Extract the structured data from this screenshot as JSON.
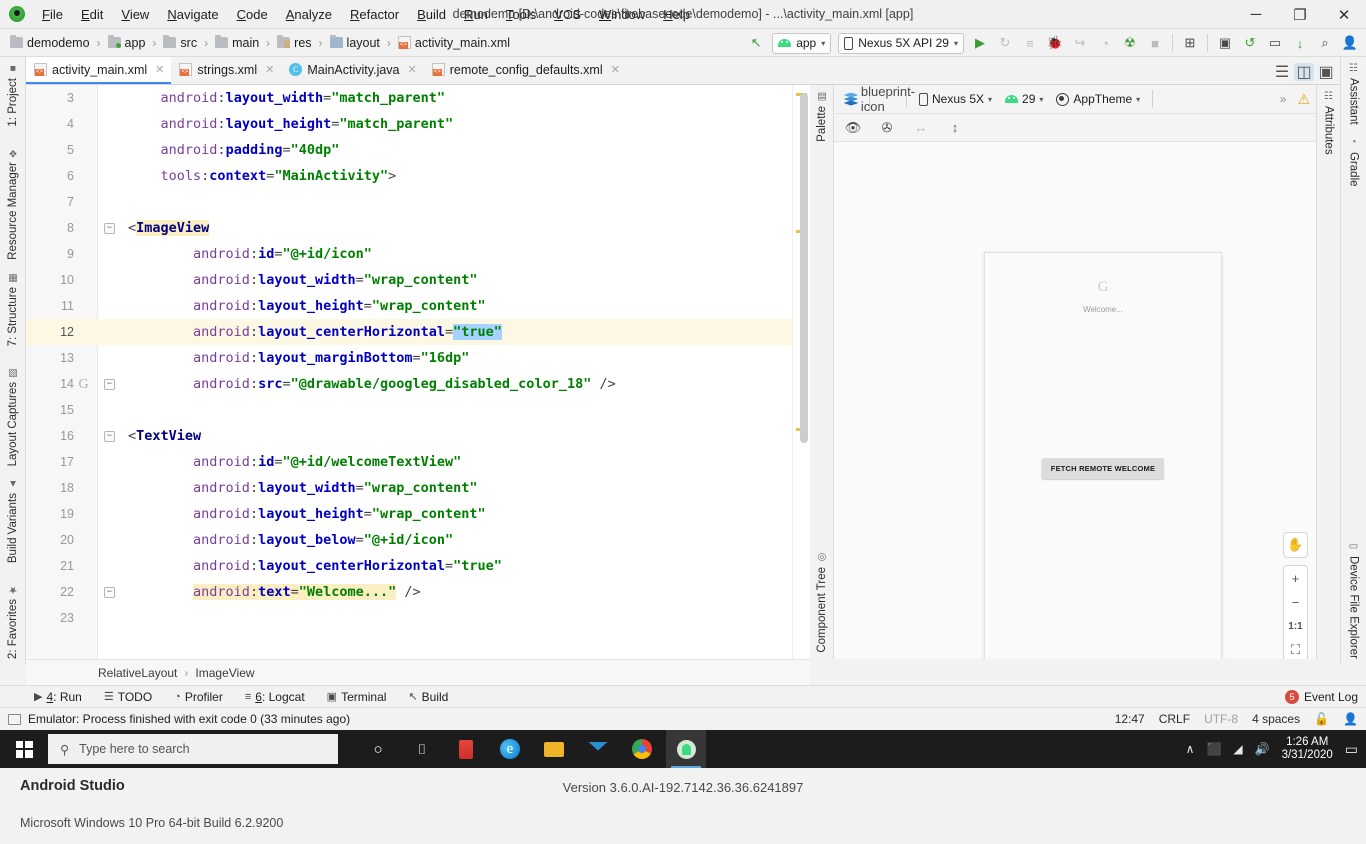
{
  "window": {
    "title": "demodemo [D:\\android-codes\\firebasecode\\demodemo] - ...\\activity_main.xml [app]",
    "minimize": "─",
    "maximize": "❐",
    "close": "✕"
  },
  "menu": [
    "File",
    "Edit",
    "View",
    "Navigate",
    "Code",
    "Analyze",
    "Refactor",
    "Build",
    "Run",
    "Tools",
    "VCS",
    "Window",
    "Help"
  ],
  "breadcrumb": [
    {
      "label": "demodemo",
      "icon": "folder-icon"
    },
    {
      "label": "app",
      "icon": "module-folder-icon"
    },
    {
      "label": "src",
      "icon": "folder-icon"
    },
    {
      "label": "main",
      "icon": "folder-icon"
    },
    {
      "label": "res",
      "icon": "res-folder-icon"
    },
    {
      "label": "layout",
      "icon": "layout-folder-icon"
    },
    {
      "label": "activity_main.xml",
      "icon": "xml-file-icon"
    }
  ],
  "toolbar": {
    "back_arrow": "↖",
    "module_selector": "app",
    "device_selector": "Nexus 5X API 29",
    "run": "▶",
    "apply_changes": "↻",
    "apply_code": "≡",
    "debug": "🐞",
    "attach_debug": "↪",
    "profile": "◔",
    "debug_run": "☢",
    "stop": "■",
    "sdk_manager": "⊞",
    "avd_manager": "▣",
    "sync_gradle": "↺",
    "device_manager": "▭",
    "download": "↓",
    "search": "⌕",
    "profile_avatar": "👤"
  },
  "tabs": [
    {
      "label": "activity_main.xml",
      "icon": "xml-file-icon",
      "active": true
    },
    {
      "label": "strings.xml",
      "icon": "xml-file-icon",
      "active": false
    },
    {
      "label": "MainActivity.java",
      "icon": "java-file-icon",
      "active": false
    },
    {
      "label": "remote_config_defaults.xml",
      "icon": "xml-file-icon",
      "active": false
    }
  ],
  "view_modes": {
    "code": "☰",
    "split": "◫",
    "design": "▣"
  },
  "left_strip": [
    {
      "label": "1: Project",
      "underline": "1"
    },
    {
      "label": "Resource Manager",
      "underline": ""
    },
    {
      "label": "7: Structure",
      "underline": "7"
    },
    {
      "label": "Layout Captures",
      "underline": ""
    },
    {
      "label": "Build Variants",
      "underline": ""
    },
    {
      "label": "2: Favorites",
      "underline": "2"
    }
  ],
  "right_strip": [
    {
      "label": "Assistant"
    },
    {
      "label": "Gradle"
    },
    {
      "label": "Device File Explorer"
    }
  ],
  "design_strip_left": [
    "Palette",
    "Component Tree"
  ],
  "design_strip_right": [
    "Attributes"
  ],
  "code": {
    "lines": [
      {
        "n": "3",
        "indent": 1,
        "tokens": [
          {
            "t": "android",
            "c": "attr"
          },
          {
            "t": ":",
            "c": "pun"
          },
          {
            "t": "layout_width",
            "c": "col"
          },
          {
            "t": "=",
            "c": "pun"
          },
          {
            "t": "\"match_parent\"",
            "c": "str"
          }
        ]
      },
      {
        "n": "4",
        "indent": 1,
        "tokens": [
          {
            "t": "android",
            "c": "attr"
          },
          {
            "t": ":",
            "c": "pun"
          },
          {
            "t": "layout_height",
            "c": "col"
          },
          {
            "t": "=",
            "c": "pun"
          },
          {
            "t": "\"match_parent\"",
            "c": "str"
          }
        ]
      },
      {
        "n": "5",
        "indent": 1,
        "tokens": [
          {
            "t": "android",
            "c": "attr"
          },
          {
            "t": ":",
            "c": "pun"
          },
          {
            "t": "padding",
            "c": "col"
          },
          {
            "t": "=",
            "c": "pun"
          },
          {
            "t": "\"40dp\"",
            "c": "str"
          }
        ]
      },
      {
        "n": "6",
        "indent": 1,
        "tokens": [
          {
            "t": "tools",
            "c": "attr"
          },
          {
            "t": ":",
            "c": "pun"
          },
          {
            "t": "context",
            "c": "col"
          },
          {
            "t": "=",
            "c": "pun"
          },
          {
            "t": "\"MainActivity\"",
            "c": "str"
          },
          {
            "t": ">",
            "c": "pun"
          }
        ]
      },
      {
        "n": "7",
        "indent": 0,
        "tokens": []
      },
      {
        "n": "8",
        "indent": 0,
        "fold": true,
        "tokens": [
          {
            "t": "<",
            "c": "pun"
          },
          {
            "t": "ImageView",
            "c": "tag",
            "hl": "yellow"
          }
        ]
      },
      {
        "n": "9",
        "indent": 2,
        "tokens": [
          {
            "t": "android",
            "c": "attr"
          },
          {
            "t": ":",
            "c": "pun"
          },
          {
            "t": "id",
            "c": "col"
          },
          {
            "t": "=",
            "c": "pun"
          },
          {
            "t": "\"@+id/icon\"",
            "c": "str"
          }
        ]
      },
      {
        "n": "10",
        "indent": 2,
        "tokens": [
          {
            "t": "android",
            "c": "attr"
          },
          {
            "t": ":",
            "c": "pun"
          },
          {
            "t": "layout_width",
            "c": "col"
          },
          {
            "t": "=",
            "c": "pun"
          },
          {
            "t": "\"wrap_content\"",
            "c": "str"
          }
        ]
      },
      {
        "n": "11",
        "indent": 2,
        "tokens": [
          {
            "t": "android",
            "c": "attr"
          },
          {
            "t": ":",
            "c": "pun"
          },
          {
            "t": "layout_height",
            "c": "col"
          },
          {
            "t": "=",
            "c": "pun"
          },
          {
            "t": "\"wrap_content\"",
            "c": "str"
          }
        ]
      },
      {
        "n": "12",
        "indent": 2,
        "current": true,
        "tokens": [
          {
            "t": "android",
            "c": "attr"
          },
          {
            "t": ":",
            "c": "pun"
          },
          {
            "t": "layout_centerHorizontal",
            "c": "col"
          },
          {
            "t": "=",
            "c": "pun"
          },
          {
            "t": "\"true\"",
            "c": "str",
            "hl": "sel"
          }
        ]
      },
      {
        "n": "13",
        "indent": 2,
        "tokens": [
          {
            "t": "android",
            "c": "attr"
          },
          {
            "t": ":",
            "c": "pun"
          },
          {
            "t": "layout_marginBottom",
            "c": "col"
          },
          {
            "t": "=",
            "c": "pun"
          },
          {
            "t": "\"16dp\"",
            "c": "str"
          }
        ]
      },
      {
        "n": "14",
        "indent": 2,
        "fold": true,
        "gmark": "G",
        "tokens": [
          {
            "t": "android",
            "c": "attr"
          },
          {
            "t": ":",
            "c": "pun"
          },
          {
            "t": "src",
            "c": "col"
          },
          {
            "t": "=",
            "c": "pun"
          },
          {
            "t": "\"@drawable/googleg_disabled_color_18\"",
            "c": "str"
          },
          {
            "t": " />",
            "c": "pun"
          }
        ]
      },
      {
        "n": "15",
        "indent": 0,
        "tokens": []
      },
      {
        "n": "16",
        "indent": 0,
        "fold": true,
        "tokens": [
          {
            "t": "<",
            "c": "pun"
          },
          {
            "t": "TextView",
            "c": "tag"
          }
        ]
      },
      {
        "n": "17",
        "indent": 2,
        "tokens": [
          {
            "t": "android",
            "c": "attr"
          },
          {
            "t": ":",
            "c": "pun"
          },
          {
            "t": "id",
            "c": "col"
          },
          {
            "t": "=",
            "c": "pun"
          },
          {
            "t": "\"@+id/welcomeTextView\"",
            "c": "str"
          }
        ]
      },
      {
        "n": "18",
        "indent": 2,
        "tokens": [
          {
            "t": "android",
            "c": "attr"
          },
          {
            "t": ":",
            "c": "pun"
          },
          {
            "t": "layout_width",
            "c": "col"
          },
          {
            "t": "=",
            "c": "pun"
          },
          {
            "t": "\"wrap_content\"",
            "c": "str"
          }
        ]
      },
      {
        "n": "19",
        "indent": 2,
        "tokens": [
          {
            "t": "android",
            "c": "attr"
          },
          {
            "t": ":",
            "c": "pun"
          },
          {
            "t": "layout_height",
            "c": "col"
          },
          {
            "t": "=",
            "c": "pun"
          },
          {
            "t": "\"wrap_content\"",
            "c": "str"
          }
        ]
      },
      {
        "n": "20",
        "indent": 2,
        "tokens": [
          {
            "t": "android",
            "c": "attr"
          },
          {
            "t": ":",
            "c": "pun"
          },
          {
            "t": "layout_below",
            "c": "col"
          },
          {
            "t": "=",
            "c": "pun"
          },
          {
            "t": "\"@+id/icon\"",
            "c": "str"
          }
        ]
      },
      {
        "n": "21",
        "indent": 2,
        "tokens": [
          {
            "t": "android",
            "c": "attr"
          },
          {
            "t": ":",
            "c": "pun"
          },
          {
            "t": "layout_centerHorizontal",
            "c": "col"
          },
          {
            "t": "=",
            "c": "pun"
          },
          {
            "t": "\"true\"",
            "c": "str"
          }
        ]
      },
      {
        "n": "22",
        "indent": 2,
        "fold": true,
        "tokens": [
          {
            "t": "android",
            "c": "attr",
            "hl": "yellow"
          },
          {
            "t": ":",
            "c": "pun",
            "hl": "yellow"
          },
          {
            "t": "text",
            "c": "col",
            "hl": "yellow"
          },
          {
            "t": "=",
            "c": "pun",
            "hl": "yellow"
          },
          {
            "t": "\"Welcome...\"",
            "c": "str",
            "hl": "yellow"
          },
          {
            "t": " />",
            "c": "pun"
          }
        ]
      },
      {
        "n": "23",
        "indent": 0,
        "tokens": []
      }
    ]
  },
  "editor_breadcrumb": [
    "RelativeLayout",
    "ImageView"
  ],
  "design": {
    "toolbar": {
      "design_surface": "layers-icon",
      "blueprint": "blueprint-icon",
      "device": "Nexus 5X",
      "api": "29",
      "theme": "AppTheme",
      "overflow": "»",
      "warning": "⚠"
    },
    "toolbar2": {
      "eye": "👁",
      "magnet": "✇",
      "horizontal": "↔",
      "vertical": "↕"
    },
    "preview": {
      "logo": "G",
      "welcome_text": "Welcome...",
      "button_label": "FETCH REMOTE WELCOME"
    },
    "zoom_controls": {
      "pan": "✋",
      "zoom_in": "+",
      "zoom_out": "−",
      "actual_size": "1:1",
      "fit_screen": "⛶"
    }
  },
  "tool_windows": [
    {
      "label": "4: Run",
      "underline": "4",
      "icon": "▶"
    },
    {
      "label": "TODO",
      "underline": "",
      "icon": "☰"
    },
    {
      "label": "Profiler",
      "underline": "",
      "icon": "◔"
    },
    {
      "label": "6: Logcat",
      "underline": "6",
      "icon": "≡"
    },
    {
      "label": "Terminal",
      "underline": "",
      "icon": "▣"
    },
    {
      "label": "Build",
      "underline": "",
      "icon": "↖"
    }
  ],
  "event_log": {
    "label": "Event Log",
    "count": "5"
  },
  "status": {
    "message": "Emulator: Process finished with exit code 0 (33 minutes ago)",
    "position": "12:47",
    "line_separator": "CRLF",
    "encoding": "UTF-8",
    "indent": "4 spaces",
    "lock": "🔓",
    "inspector": "👤"
  },
  "taskbar": {
    "search_placeholder": "Type here to search",
    "search_icon": "⚲",
    "cortana": "○",
    "task_view": "⌷",
    "apps": [
      "office-icon",
      "edge-icon",
      "explorer-icon",
      "mail-icon",
      "chrome-icon",
      "android-studio-icon"
    ],
    "tray": {
      "chevron": "∧",
      "battery": "⬛",
      "wifi": "◢",
      "volume": "🔊",
      "time": "1:26 AM",
      "date": "3/31/2020",
      "notifications": "▭"
    }
  },
  "about": {
    "product": "Android Studio",
    "version": "Version 3.6.0.AI-192.7142.36.36.6241897",
    "os": "Microsoft Windows 10 Pro 64-bit Build 6.2.9200"
  },
  "colors": {
    "accent": "#4285f4",
    "android_green": "#3ddc84",
    "warning": "#e8a317",
    "error_badge": "#d94a3c",
    "current_line": "#fdf8e3",
    "selection": "#a6d2ff"
  }
}
